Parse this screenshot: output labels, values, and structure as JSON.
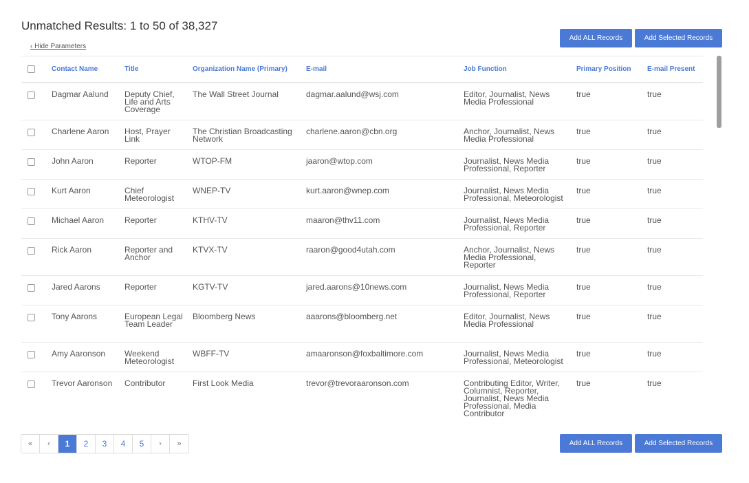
{
  "header": {
    "title": "Unmatched Results: 1 to 50 of 38,327",
    "hide_parameters": "‹ Hide Parameters"
  },
  "actions": {
    "add_all": "Add ALL Records",
    "add_selected": "Add Selected Records"
  },
  "table": {
    "columns": [
      "Contact Name",
      "Title",
      "Organization Name (Primary)",
      "E-mail",
      "Job Function",
      "Primary Position",
      "E-mail Present"
    ],
    "rows": [
      {
        "name": "Dagmar Aalund",
        "title": "Deputy Chief, Life and Arts Coverage",
        "org": "The Wall Street Journal",
        "email": "dagmar.aalund@wsj.com",
        "job": "Editor, Journalist, News Media Professional",
        "primary": "true",
        "email_present": "true"
      },
      {
        "name": "Charlene Aaron",
        "title": "Host, Prayer Link",
        "org": "The Christian Broadcasting Network",
        "email": "charlene.aaron@cbn.org",
        "job": "Anchor, Journalist, News Media Professional",
        "primary": "true",
        "email_present": "true"
      },
      {
        "name": "John Aaron",
        "title": "Reporter",
        "org": "WTOP-FM",
        "email": "jaaron@wtop.com",
        "job": "Journalist, News Media Professional, Reporter",
        "primary": "true",
        "email_present": "true"
      },
      {
        "name": "Kurt Aaron",
        "title": "Chief Meteorologist",
        "org": "WNEP-TV",
        "email": "kurt.aaron@wnep.com",
        "job": "Journalist, News Media Professional, Meteorologist",
        "primary": "true",
        "email_present": "true"
      },
      {
        "name": "Michael Aaron",
        "title": "Reporter",
        "org": "KTHV-TV",
        "email": "maaron@thv11.com",
        "job": "Journalist, News Media Professional, Reporter",
        "primary": "true",
        "email_present": "true"
      },
      {
        "name": "Rick Aaron",
        "title": "Reporter and Anchor",
        "org": "KTVX-TV",
        "email": "raaron@good4utah.com",
        "job": "Anchor, Journalist, News Media Professional, Reporter",
        "primary": "true",
        "email_present": "true"
      },
      {
        "name": "Jared Aarons",
        "title": "Reporter",
        "org": "KGTV-TV",
        "email": "jared.aarons@10news.com",
        "job": "Journalist, News Media Professional, Reporter",
        "primary": "true",
        "email_present": "true"
      },
      {
        "name": "Tony Aarons",
        "title": "European Legal Team Leader",
        "org": "Bloomberg News",
        "email": "aaarons@bloomberg.net",
        "job": "Editor, Journalist, News Media Professional",
        "primary": "true",
        "email_present": "true"
      },
      {
        "name": "Amy Aaronson",
        "title": "Weekend Meteorologist",
        "org": "WBFF-TV",
        "email": "amaaronson@foxbaltimore.com",
        "job": "Journalist, News Media Professional, Meteorologist",
        "primary": "true",
        "email_present": "true"
      },
      {
        "name": "Trevor Aaronson",
        "title": "Contributor",
        "org": "First Look Media",
        "email": "trevor@trevoraaronson.com",
        "job": "Contributing Editor, Writer, Columnist, Reporter, Journalist, News Media Professional, Media Contributor",
        "primary": "true",
        "email_present": "true"
      }
    ]
  },
  "pagination": {
    "first": "«",
    "prev": "‹",
    "pages": [
      "1",
      "2",
      "3",
      "4",
      "5"
    ],
    "active": "1",
    "next": "›",
    "last": "»"
  }
}
